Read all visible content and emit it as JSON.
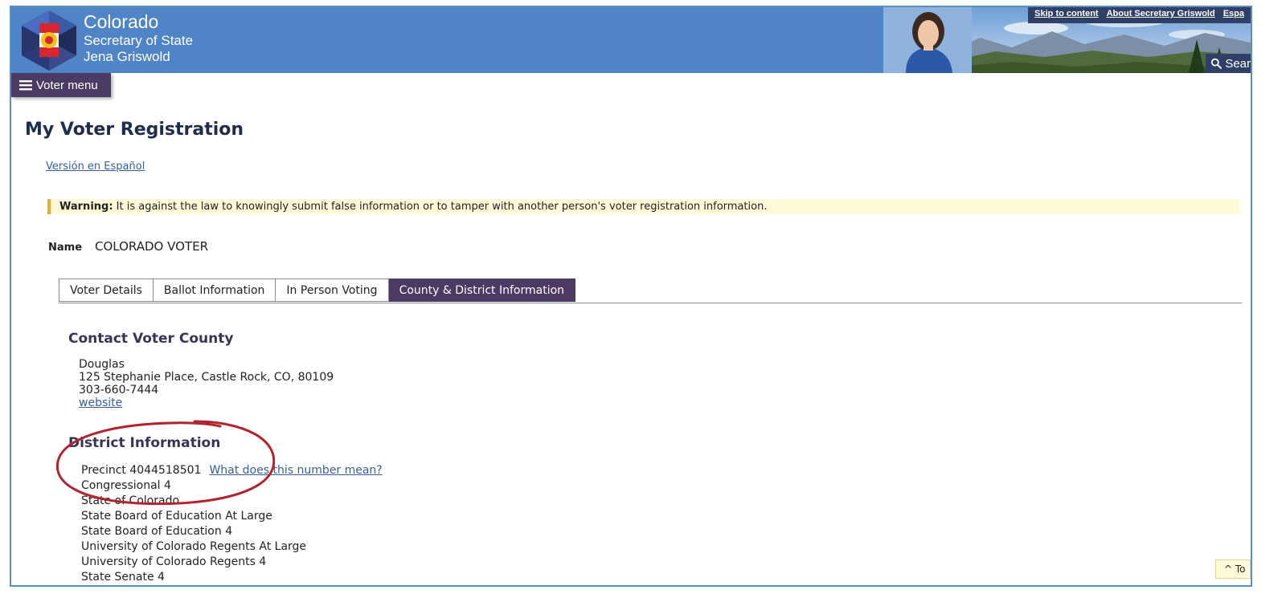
{
  "header": {
    "title_line1": "Colorado",
    "title_line2": "Secretary of State",
    "title_line3": "Jena Griswold",
    "links": [
      "Skip to content",
      "About Secretary Griswold",
      "Espa"
    ],
    "search_label": "Sear",
    "brand_color": "#4f84c6",
    "dark_color": "#2f3f66"
  },
  "voter_menu": {
    "label": "Voter menu",
    "icon": "hamburger-icon"
  },
  "page": {
    "title": "My Voter Registration",
    "espanol_link": "Versión en Español",
    "warning_label": "Warning:",
    "warning_text": " It is against the law to knowingly submit false information or to tamper with another person's voter registration information.",
    "name_label": "Name",
    "name_value": "COLORADO VOTER"
  },
  "tabs": [
    {
      "label": "Voter Details",
      "active": false
    },
    {
      "label": "Ballot Information",
      "active": false
    },
    {
      "label": "In Person Voting",
      "active": false
    },
    {
      "label": "County & District Information",
      "active": true
    }
  ],
  "contact": {
    "title": "Contact Voter County",
    "county": "Douglas",
    "address": "125 Stephanie Place, Castle Rock, CO, 80109",
    "phone": "303-660-7444",
    "website_label": "website"
  },
  "district": {
    "title": "District Information",
    "precinct": "Precinct 4044518501",
    "precinct_help": "What does this number mean?",
    "items": [
      "Congressional 4",
      "State of Colorado",
      "State Board of Education At Large",
      "State Board of Education 4",
      "University of Colorado Regents At Large",
      "University of Colorado Regents 4",
      "State Senate 4"
    ]
  },
  "to_top": "^ To",
  "colors": {
    "accent_purple": "#4b3a63",
    "warning_bg": "#fffbd9",
    "warning_bar": "#f2a830",
    "annotation_red": "#b3232e"
  }
}
